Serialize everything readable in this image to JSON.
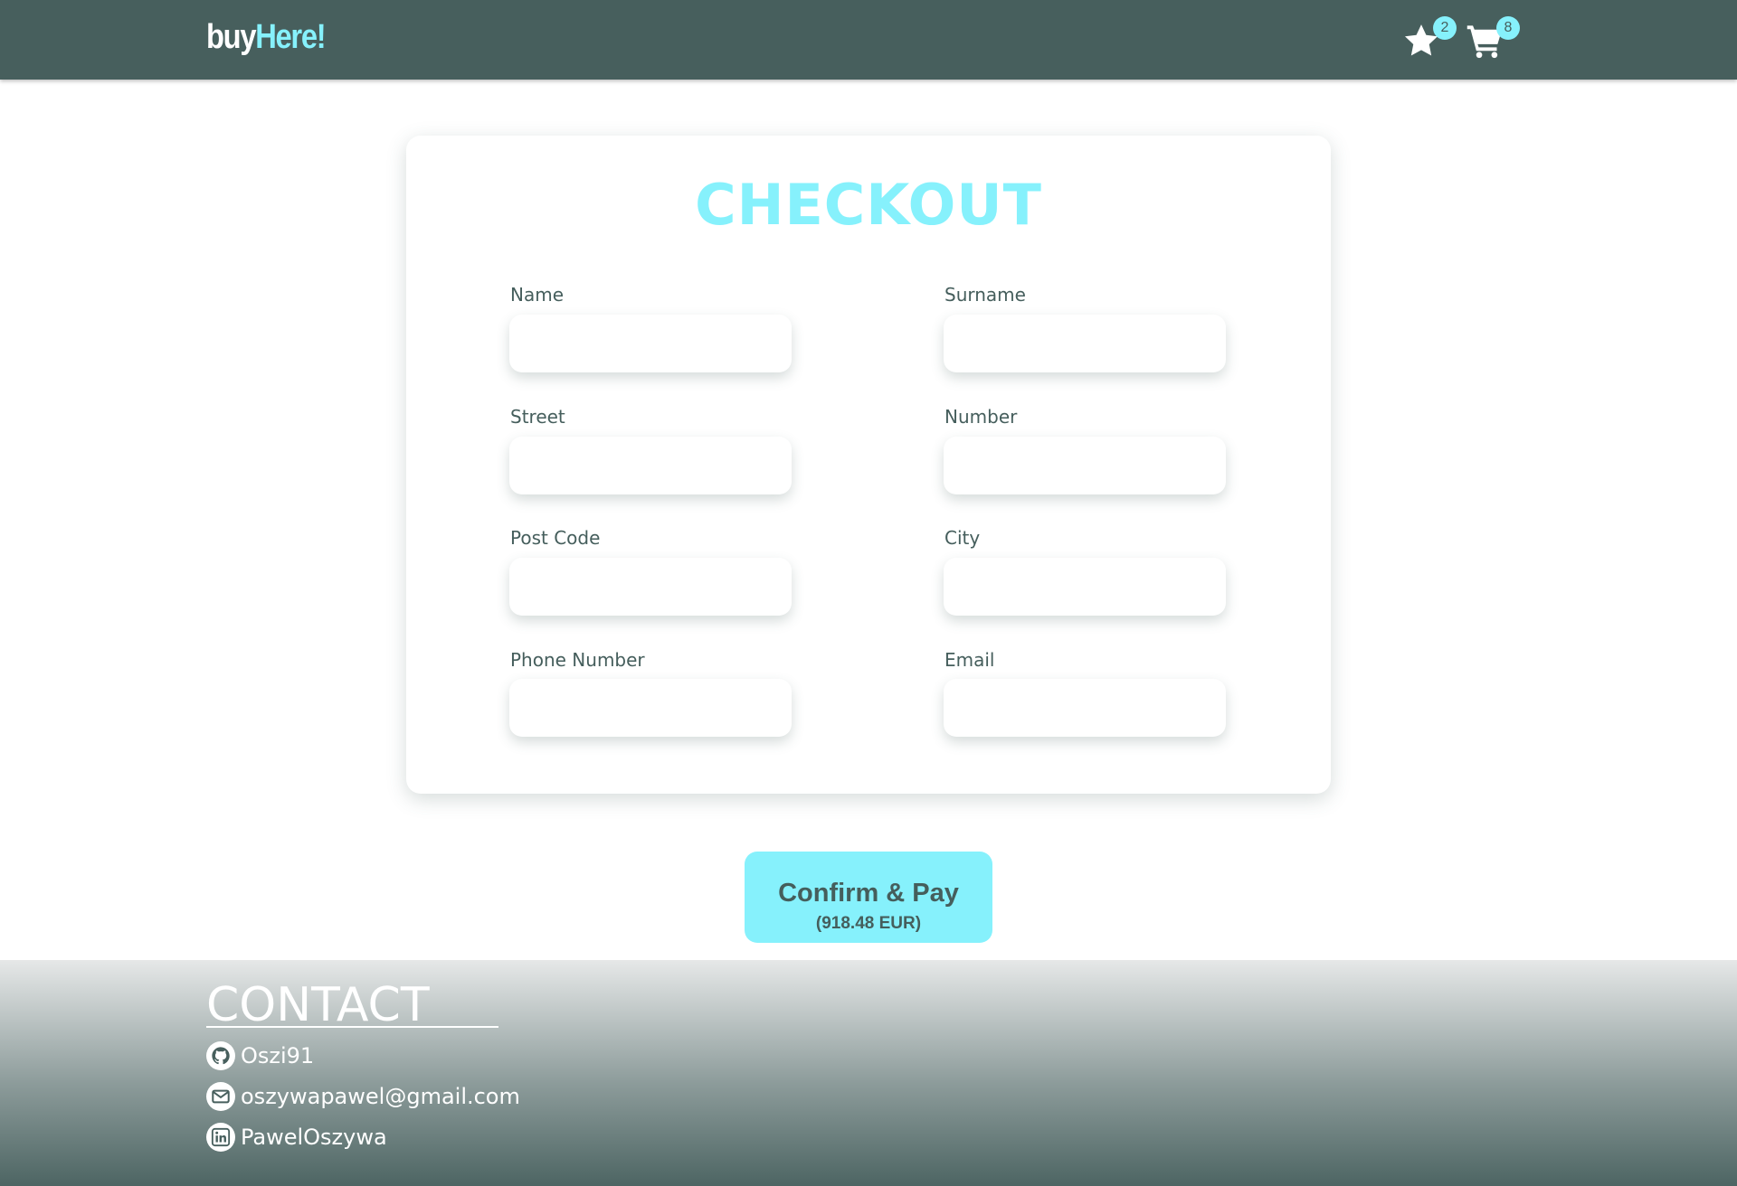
{
  "header": {
    "logo_part1": "buy",
    "logo_part2": "Here!",
    "favorites_count": "2",
    "cart_count": "8"
  },
  "checkout": {
    "title": "CHECKOUT",
    "fields": [
      {
        "label": "Name",
        "value": ""
      },
      {
        "label": "Surname",
        "value": ""
      },
      {
        "label": "Street",
        "value": ""
      },
      {
        "label": "Number",
        "value": ""
      },
      {
        "label": "Post Code",
        "value": ""
      },
      {
        "label": "City",
        "value": ""
      },
      {
        "label": "Phone Number",
        "value": ""
      },
      {
        "label": "Email",
        "value": ""
      }
    ],
    "confirm_label": "Confirm & Pay",
    "confirm_amount": "(918.48 EUR)"
  },
  "footer": {
    "title": "CONTACT",
    "items": [
      {
        "icon": "github-icon",
        "text": "Oszi91"
      },
      {
        "icon": "envelope-icon",
        "text": "oszywapawel@gmail.com"
      },
      {
        "icon": "linkedin-icon",
        "text": "PawelOszywa"
      }
    ]
  },
  "colors": {
    "header_bg": "#475f5d",
    "accent": "#86f1fc",
    "text": "#455e5c"
  }
}
